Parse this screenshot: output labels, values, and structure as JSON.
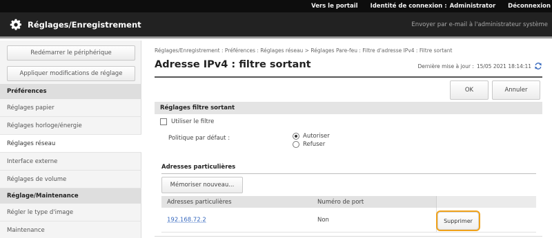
{
  "header": {
    "portal_link": "Vers le portail",
    "login_id_label": "Identité de connexion :",
    "login_id_value": "Administrator",
    "logout_link": "Déconnexion",
    "app_title": "Réglages/Enregistrement",
    "email_admin_link": "Envoyer par e-mail à l'administrateur système",
    "icons": {
      "app": "gear-icon"
    }
  },
  "sidebar": {
    "restart_button": "Redémarrer le périphérique",
    "apply_button": "Appliquer modifications de réglage",
    "preferences_head": "Préférences",
    "preferences_items": [
      {
        "label": "Réglages papier"
      },
      {
        "label": "Réglages horloge/énergie"
      },
      {
        "label": "Réglages réseau"
      },
      {
        "label": "Interface externe"
      },
      {
        "label": "Réglages de volume"
      }
    ],
    "maintenance_head": "Réglage/Maintenance",
    "maintenance_items": [
      {
        "label": "Régler le type d'image"
      },
      {
        "label": "Maintenance"
      }
    ]
  },
  "main": {
    "breadcrumb": "Réglages/Enregistrement : Préférences : Réglages réseau > Réglages Pare-feu : Filtre d'adresse IPv4 : Filtre sortant",
    "title": "Adresse IPv4 : filtre sortant",
    "last_update_label": "Dernière mise à jour :",
    "last_update_value": "15/05 2021 18:14:11",
    "ok_button": "OK",
    "cancel_button": "Annuler",
    "filter_section": {
      "title": "Réglages filtre sortant",
      "use_filter_label": "Utiliser le filtre",
      "use_filter_checked": false,
      "default_policy_label": "Politique par défaut :",
      "policy_options": [
        "Autoriser",
        "Refuser"
      ],
      "policy_selected": "Autoriser"
    },
    "exceptions": {
      "title": "Adresses particulières",
      "register_button": "Mémoriser nouveau...",
      "col_address": "Adresses particulières",
      "col_port": "Numéro de port",
      "rows": [
        {
          "address": "192.168.72.2",
          "port": "Non",
          "delete_label": "Supprimer"
        }
      ]
    }
  },
  "colors": {
    "top_bar": "#0d0d0d",
    "title_bar": "#222222",
    "link_blue": "#3a6bbf",
    "highlight": "#f0a21a"
  }
}
